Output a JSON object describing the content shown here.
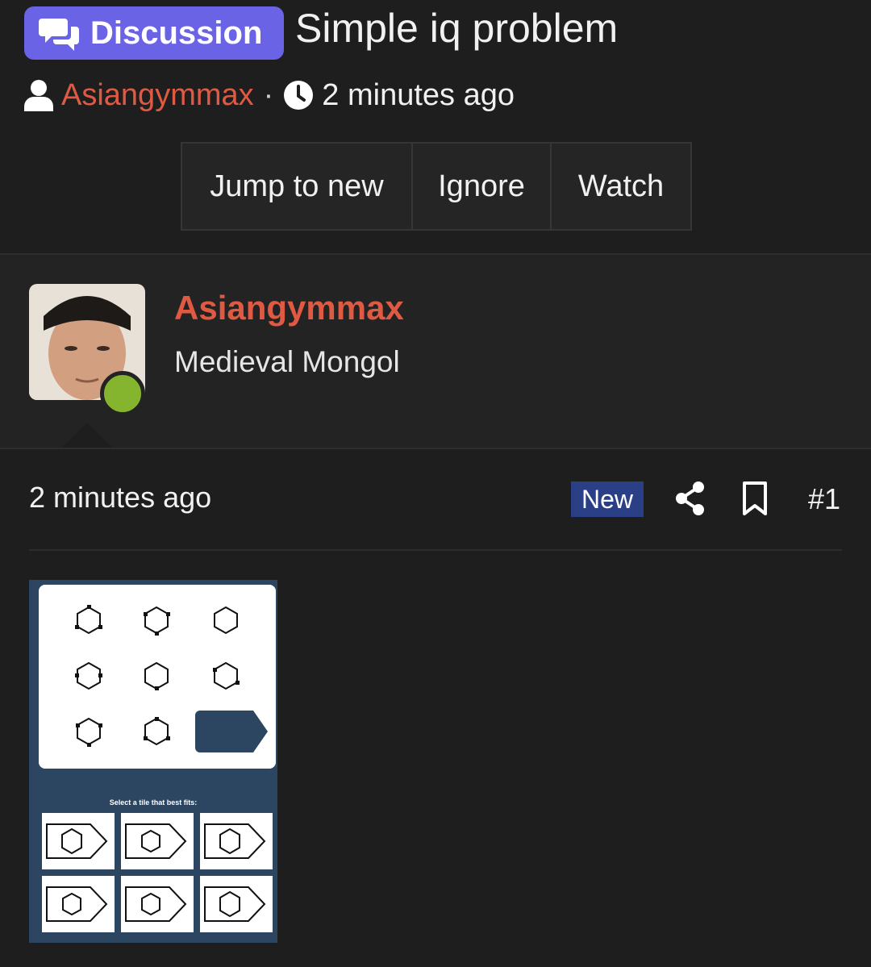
{
  "header": {
    "badge_label": "Discussion",
    "title": "Simple iq problem"
  },
  "meta": {
    "author": "Asiangymmax",
    "separator": "·",
    "time": "2 minutes ago"
  },
  "actions": {
    "jump_label": "Jump to new",
    "ignore_label": "Ignore",
    "watch_label": "Watch"
  },
  "user": {
    "name": "Asiangymmax",
    "title": "Medieval Mongol",
    "online": true
  },
  "post": {
    "time": "2 minutes ago",
    "new_label": "New",
    "number": "#1"
  },
  "attachment": {
    "caption": "Select a tile that best fits:"
  },
  "colors": {
    "badge": "#6b63e6",
    "author": "#e05a43",
    "new_badge": "#2b3f86",
    "online": "#85b52e",
    "puzzle_bg": "#2c4560"
  },
  "icons": {
    "badge": "chat-bubbles-icon",
    "author": "user-icon",
    "time": "clock-icon",
    "share": "share-icon",
    "bookmark": "bookmark-icon"
  }
}
